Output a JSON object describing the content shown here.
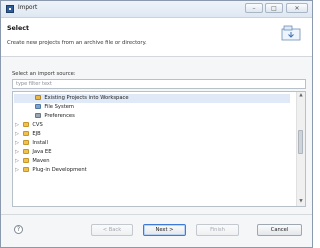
{
  "window": {
    "title": "Import",
    "controls": [
      "–",
      "□",
      "✕"
    ]
  },
  "header": {
    "title": "Select",
    "description": "Create new projects from an archive file or directory."
  },
  "source": {
    "label": "Select an import source:",
    "filter_placeholder": "type filter text"
  },
  "tree": {
    "items": [
      {
        "label": "Existing Projects into Workspace",
        "depth": 1,
        "icon": "project-icon",
        "selected": true
      },
      {
        "label": "File System",
        "depth": 1,
        "icon": "file-system-icon"
      },
      {
        "label": "Preferences",
        "depth": 1,
        "icon": "preferences-icon"
      },
      {
        "label": "CVS",
        "depth": 0,
        "icon": "folder-icon",
        "expandable": true
      },
      {
        "label": "EJB",
        "depth": 0,
        "icon": "folder-icon",
        "expandable": true
      },
      {
        "label": "Install",
        "depth": 0,
        "icon": "folder-icon",
        "expandable": true
      },
      {
        "label": "Java EE",
        "depth": 0,
        "icon": "folder-icon",
        "expandable": true
      },
      {
        "label": "Maven",
        "depth": 0,
        "icon": "folder-icon",
        "expandable": true
      },
      {
        "label": "Plug-in Development",
        "depth": 0,
        "icon": "folder-icon",
        "expandable": true
      }
    ]
  },
  "buttons": {
    "back": "< Back",
    "next": "Next >",
    "finish": "Finish",
    "cancel": "Cancel",
    "help": "?"
  }
}
